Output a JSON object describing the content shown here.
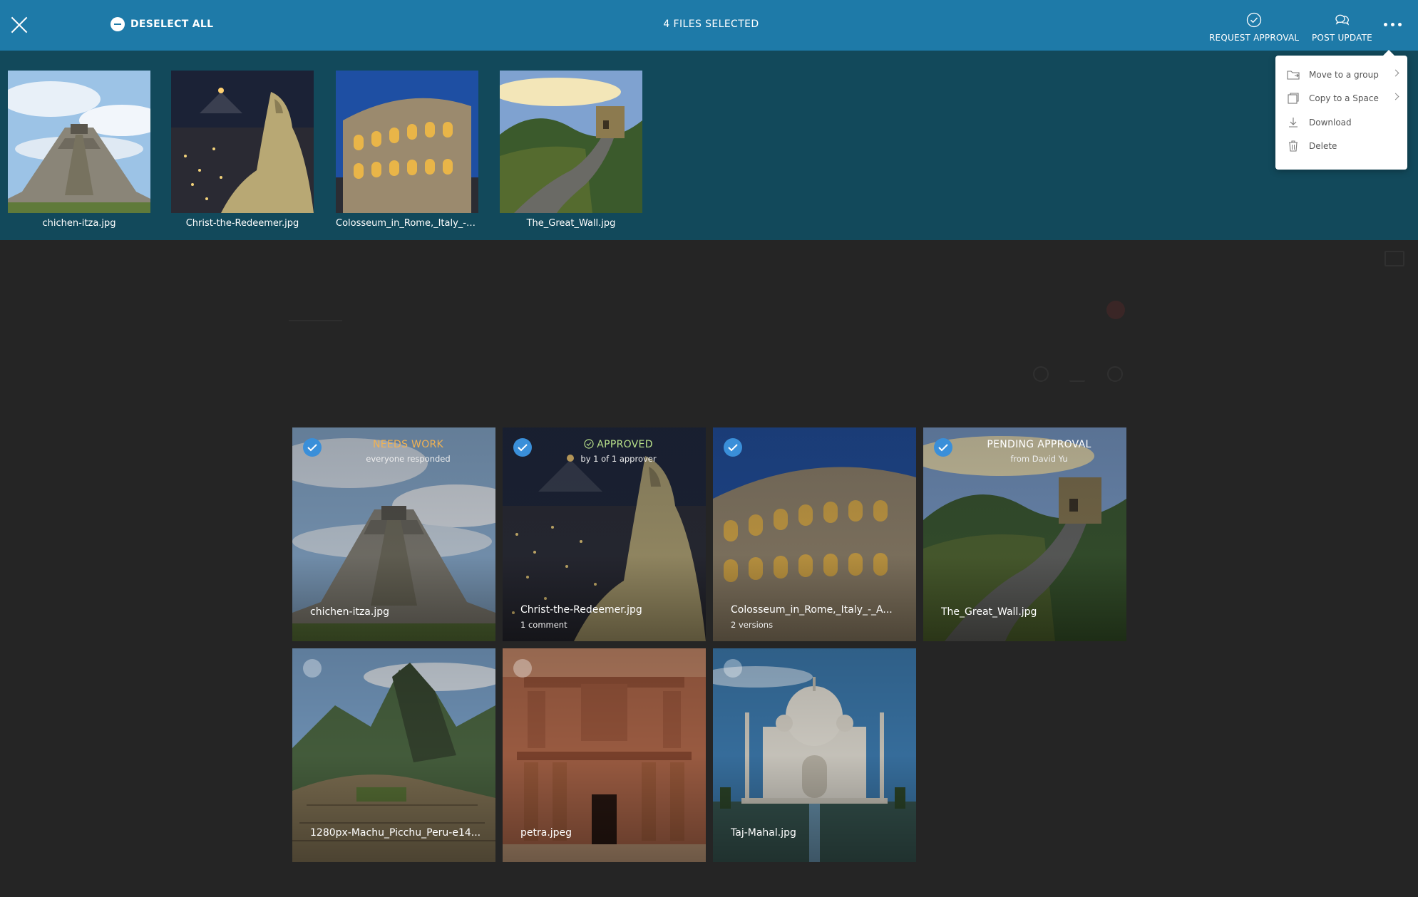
{
  "topbar": {
    "deselect_label": "DESELECT ALL",
    "files_selected": "4 FILES SELECTED",
    "request_approval": "REQUEST APPROVAL",
    "post_update": "POST UPDATE"
  },
  "tray": {
    "items": [
      {
        "label": "chichen-itza.jpg"
      },
      {
        "label": "Christ-the-Redeemer.jpg"
      },
      {
        "label": "Colosseum_in_Rome,_Italy_-_A..."
      },
      {
        "label": "The_Great_Wall.jpg"
      }
    ]
  },
  "menu": {
    "items": [
      {
        "label": "Move to a group"
      },
      {
        "label": "Copy to a Space"
      },
      {
        "label": "Download"
      },
      {
        "label": "Delete"
      }
    ]
  },
  "tiles": [
    {
      "name": "chichen-itza.jpg",
      "status": "NEEDS WORK",
      "status_sub": "everyone responded",
      "meta": ""
    },
    {
      "name": "Christ-the-Redeemer.jpg",
      "status": "APPROVED",
      "status_sub": "by 1 of 1 approver",
      "meta": "1 comment"
    },
    {
      "name": "Colosseum_in_Rome,_Italy_-_A...",
      "status": "",
      "status_sub": "",
      "meta": "2 versions"
    },
    {
      "name": "The_Great_Wall.jpg",
      "status": "PENDING APPROVAL",
      "status_sub": "from David Yu",
      "meta": ""
    },
    {
      "name": "1280px-Machu_Picchu_Peru-e14...",
      "status": "",
      "status_sub": "",
      "meta": ""
    },
    {
      "name": "petra.jpeg",
      "status": "",
      "status_sub": "",
      "meta": ""
    },
    {
      "name": "Taj-Mahal.jpg",
      "status": "",
      "status_sub": "",
      "meta": ""
    }
  ],
  "colors": {
    "topbar": "#1e7aa8",
    "tray": "#12495b",
    "needs_work": "#f0b254",
    "approved": "#b8e08a",
    "check": "#3a8fd9"
  }
}
